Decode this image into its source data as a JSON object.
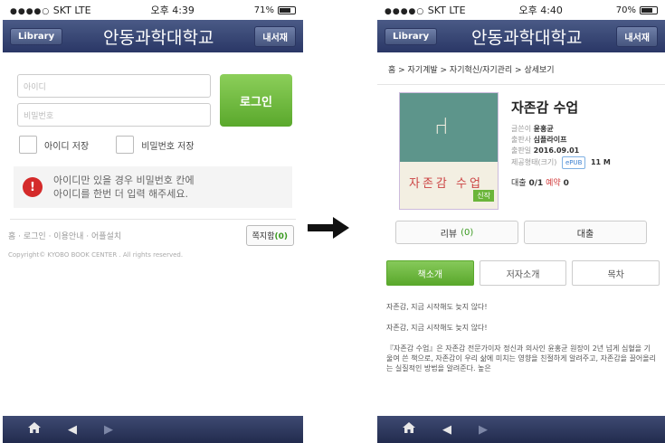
{
  "left": {
    "status": {
      "signal": "●●●●○",
      "carrier": "SKT  LTE",
      "time": "오후 4:39",
      "battery": "71%"
    },
    "nav": {
      "library": "Library",
      "title": "안동과학대학교",
      "myshelf": "내서재"
    },
    "login": {
      "id_placeholder": "아이디",
      "pw_placeholder": "비밀번호",
      "button": "로그인"
    },
    "checks": {
      "save_id": "아이디 저장",
      "save_pw": "비밀번호 저장"
    },
    "notice": {
      "line1": "아이디만 있을 경우 비밀번호 칸에",
      "line2": "아이디를 한번 더 입력 해주세요."
    },
    "footer": {
      "links": "홈 · 로그인 · 이용안내 · 어플설치",
      "messages_label": "쪽지함",
      "messages_count": "(0)",
      "copyright": "Copyright© KYOBO BOOK CENTER . All rights reserved."
    }
  },
  "right": {
    "status": {
      "signal": "●●●●○",
      "carrier": "SKT  LTE",
      "time": "오후 4:40",
      "battery": "70%"
    },
    "nav": {
      "library": "Library",
      "title": "안동과학대학교",
      "myshelf": "내서재"
    },
    "breadcrumb": "홈 > 자기계발 > 자기혁신/자기관리 > 상세보기",
    "book": {
      "title": "자존감 수업",
      "cover_title": "자존감 수업",
      "cover_badge": "신작",
      "author_label": "글쓴이",
      "author": "윤홍균",
      "publisher_label": "출판사",
      "publisher": "심플라이프",
      "date_label": "출판일",
      "date": "2016.09.01",
      "format_label": "제공형태(크기)",
      "format": "ePUB",
      "size": "11 M",
      "loan_label": "대출",
      "loan": "0/1",
      "reserve_label": "예약",
      "reserve": "0"
    },
    "actions": {
      "review": "리뷰",
      "review_count": "(0)",
      "borrow": "대출"
    },
    "tabs": [
      "책소개",
      "저자소개",
      "목차"
    ],
    "description": [
      "자존감, 지금 시작해도 늦지 않다!",
      "자존감, 지금 시작해도 늦지 않다!",
      "『자존감 수업』은 자존감 전문가이자 정신과 의사인 윤홍균 원장이 2년 넘게 심혈을 기울여 쓴 책으로, 자존감이 우리 삶에 미치는 영향을 친절하게 알려주고, 자존감을 끌어올리는 실질적인 방법을 알려준다. 높은"
    ]
  },
  "icons": {
    "home": "home-icon",
    "back": "back-icon",
    "forward": "forward-icon",
    "transition": "right-arrow-icon"
  },
  "colors": {
    "navbar": "#2a3766",
    "accent_green": "#5aa82c",
    "warning_red": "#d42a2a"
  }
}
